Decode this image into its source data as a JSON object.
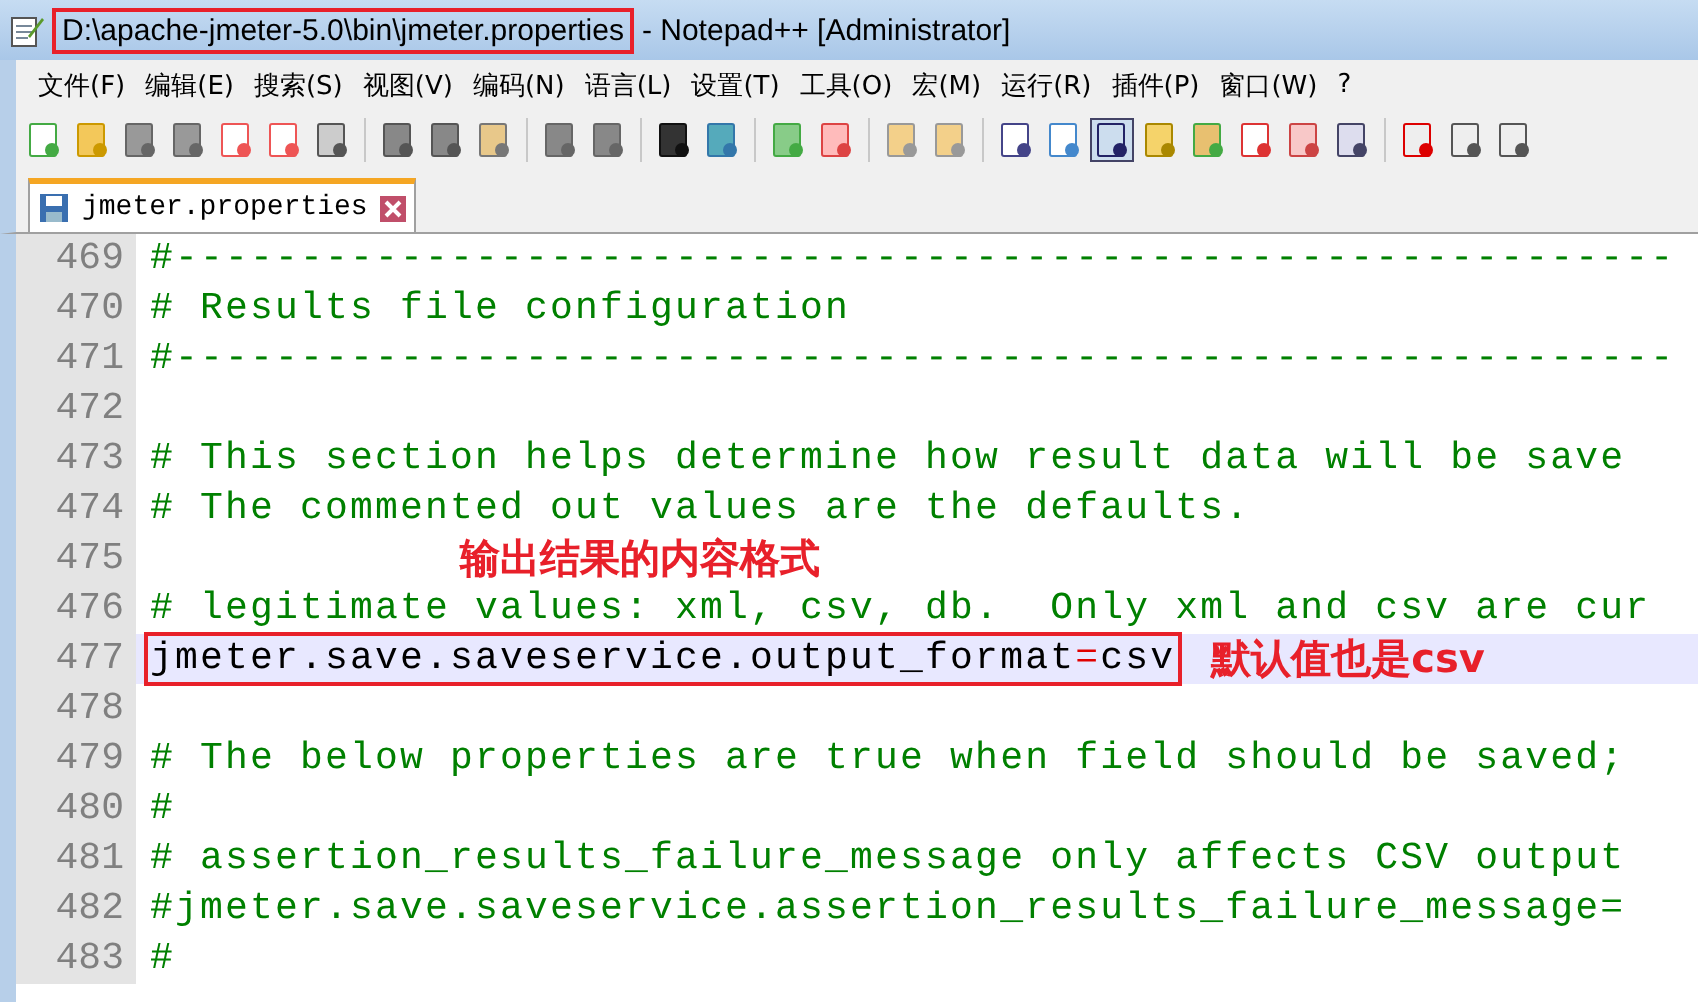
{
  "window": {
    "title_path": "D:\\apache-jmeter-5.0\\bin\\jmeter.properties",
    "path_boxed": true,
    "title_rest": "- Notepad++ [Administrator]"
  },
  "menu": [
    "文件(F)",
    "编辑(E)",
    "搜索(S)",
    "视图(V)",
    "编码(N)",
    "语言(L)",
    "设置(T)",
    "工具(O)",
    "宏(M)",
    "运行(R)",
    "插件(P)",
    "窗口(W)",
    "?"
  ],
  "tabs": [
    {
      "label": "jmeter.properties",
      "selected": true
    }
  ],
  "editor": {
    "lines": [
      {
        "number": "469",
        "kind": "comment",
        "text": "#------------------------------------------------------------",
        "current": false
      },
      {
        "number": "470",
        "kind": "comment",
        "text": "# Results file configuration",
        "current": false
      },
      {
        "number": "471",
        "kind": "comment",
        "text": "#------------------------------------------------------------",
        "current": false
      },
      {
        "number": "472",
        "kind": "blank",
        "current": false
      },
      {
        "number": "473",
        "kind": "comment",
        "text": "# This section helps determine how result data will be save",
        "current": false
      },
      {
        "number": "474",
        "kind": "comment",
        "text": "# The commented out values are the defaults.",
        "current": false
      },
      {
        "number": "475",
        "kind": "blank",
        "current": false,
        "note": "输出结果的内容格式"
      },
      {
        "number": "476",
        "kind": "comment",
        "text": "# legitimate values: xml, csv, db.  Only xml and csv are cur",
        "current": false
      },
      {
        "number": "477",
        "kind": "property",
        "key": "jmeter.save.saveservice.output_format",
        "operator": "=",
        "value": "csv",
        "current": true,
        "boxed": true,
        "note": "默认值也是csv"
      },
      {
        "number": "478",
        "kind": "blank",
        "current": false
      },
      {
        "number": "479",
        "kind": "comment",
        "text": "# The below properties are true when field should be saved;",
        "current": false
      },
      {
        "number": "480",
        "kind": "comment",
        "text": "#",
        "current": false
      },
      {
        "number": "481",
        "kind": "comment",
        "text": "# assertion_results_failure_message only affects CSV output",
        "current": false
      },
      {
        "number": "482",
        "kind": "comment",
        "text": "#jmeter.save.saveservice.assertion_results_failure_message=",
        "current": false
      },
      {
        "number": "483",
        "kind": "comment",
        "text": "#",
        "current": false
      }
    ]
  }
}
